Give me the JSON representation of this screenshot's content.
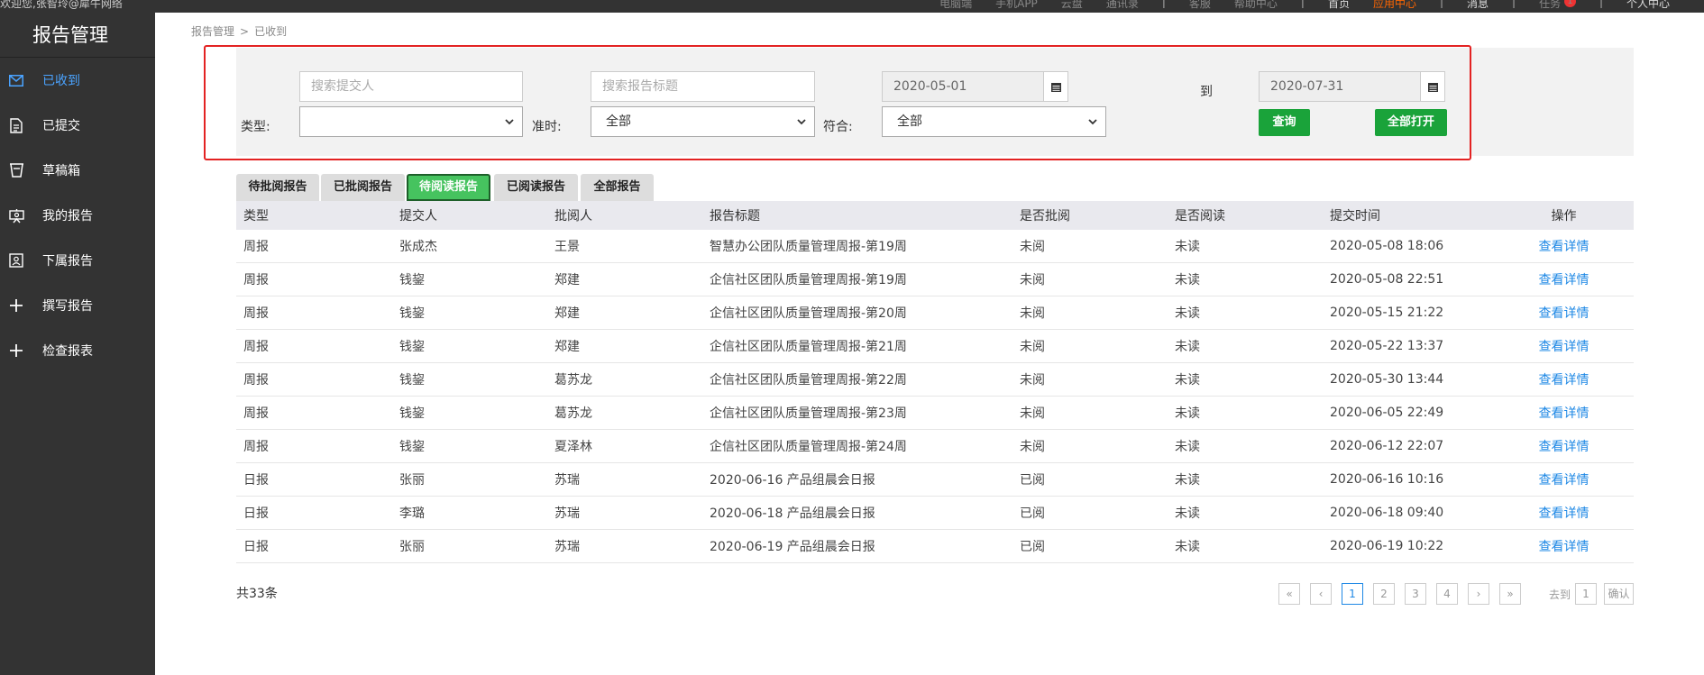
{
  "topbar": {
    "welcome": "欢迎您,张智玲@犀牛网络",
    "links": [
      "电脑端",
      "手机APP",
      "云盘",
      "通讯录"
    ],
    "sep1": "|",
    "links2": [
      "客服",
      "帮助中心"
    ],
    "sep2": "|",
    "home": "首页",
    "app_center": "应用中心",
    "sep3": "|",
    "messages": "消息",
    "sep4": "|",
    "tasks": "任务",
    "task_badge": "1",
    "sep5": "|",
    "personal": "个人中心"
  },
  "sidebar": {
    "title": "报告管理",
    "items": [
      {
        "label": "已收到",
        "icon": "mail-icon"
      },
      {
        "label": "已提交",
        "icon": "document-icon"
      },
      {
        "label": "草稿箱",
        "icon": "inbox-icon"
      },
      {
        "label": "我的报告",
        "icon": "projector-icon"
      },
      {
        "label": "下属报告",
        "icon": "contact-card-icon"
      },
      {
        "label": "撰写报告",
        "icon": "plus-icon"
      },
      {
        "label": "检查报表",
        "icon": "plus-icon"
      }
    ]
  },
  "breadcrumb": {
    "root": "报告管理",
    "separator": ">",
    "current": "已收到"
  },
  "filters": {
    "submitter_placeholder": "搜索提交人",
    "title_placeholder": "搜索报告标题",
    "date_from": "2020-05-01",
    "to_label": "到",
    "date_to": "2020-07-31",
    "type_label": "类型:",
    "type_value": "",
    "ontime_label": "准时:",
    "ontime_value": "全部",
    "match_label": "符合:",
    "match_value": "全部",
    "search_button": "查询",
    "open_all_button": "全部打开"
  },
  "tabs": [
    "待批阅报告",
    "已批阅报告",
    "待阅读报告",
    "已阅读报告",
    "全部报告"
  ],
  "active_tab": 2,
  "table": {
    "headers": [
      "类型",
      "提交人",
      "批阅人",
      "报告标题",
      "是否批阅",
      "是否阅读",
      "提交时间",
      "操作"
    ],
    "action_label": "查看详情",
    "rows": [
      [
        "周报",
        "张成杰",
        "王景",
        "智慧办公团队质量管理周报-第19周",
        "未阅",
        "未读",
        "2020-05-08 18:06"
      ],
      [
        "周报",
        "钱鋆",
        "郑建",
        "企信社区团队质量管理周报-第19周",
        "未阅",
        "未读",
        "2020-05-08 22:51"
      ],
      [
        "周报",
        "钱鋆",
        "郑建",
        "企信社区团队质量管理周报-第20周",
        "未阅",
        "未读",
        "2020-05-15 21:22"
      ],
      [
        "周报",
        "钱鋆",
        "郑建",
        "企信社区团队质量管理周报-第21周",
        "未阅",
        "未读",
        "2020-05-22 13:37"
      ],
      [
        "周报",
        "钱鋆",
        "葛苏龙",
        "企信社区团队质量管理周报-第22周",
        "未阅",
        "未读",
        "2020-05-30 13:44"
      ],
      [
        "周报",
        "钱鋆",
        "葛苏龙",
        "企信社区团队质量管理周报-第23周",
        "未阅",
        "未读",
        "2020-06-05 22:49"
      ],
      [
        "周报",
        "钱鋆",
        "夏泽林",
        "企信社区团队质量管理周报-第24周",
        "未阅",
        "未读",
        "2020-06-12 22:07"
      ],
      [
        "日报",
        "张丽",
        "苏瑞",
        "2020-06-16 产品组晨会日报",
        "已阅",
        "未读",
        "2020-06-16 10:16"
      ],
      [
        "日报",
        "李璐",
        "苏瑞",
        "2020-06-18 产品组晨会日报",
        "已阅",
        "未读",
        "2020-06-18 09:40"
      ],
      [
        "日报",
        "张丽",
        "苏瑞",
        "2020-06-19 产品组晨会日报",
        "已阅",
        "未读",
        "2020-06-19 10:22"
      ]
    ]
  },
  "footer": {
    "total": "共33条",
    "pager": {
      "first": "«",
      "prev": "‹",
      "pages": [
        "1",
        "2",
        "3",
        "4"
      ],
      "current": "1",
      "next": "›",
      "last": "»",
      "goto_label": "去到",
      "goto_value": "1",
      "confirm": "确认"
    }
  },
  "colors": {
    "accent_green": "#1aa33a",
    "tab_active": "#46c35f",
    "link": "#1e88e5",
    "highlight_red": "#e32222",
    "sidebar_bg": "#333333"
  }
}
